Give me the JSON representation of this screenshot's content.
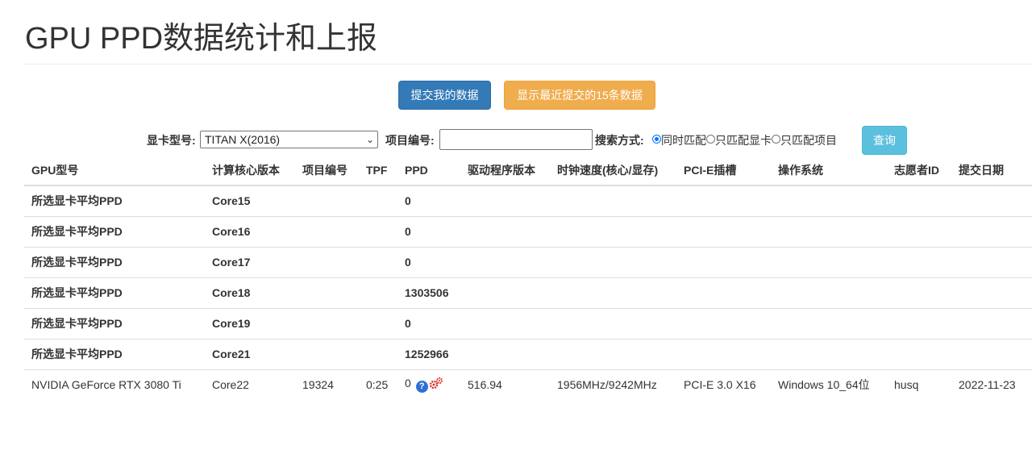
{
  "header": {
    "title": "GPU PPD数据统计和上报"
  },
  "actions": {
    "submit_label": "提交我的数据",
    "recent_label": "显示最近提交的15条数据"
  },
  "search": {
    "gpu_label": "显卡型号:",
    "gpu_selected": "TITAN X(2016)",
    "project_label": "项目编号:",
    "project_value": "",
    "mode_label": "搜索方式:",
    "modes": [
      "同时匹配",
      "只匹配显卡",
      "只匹配项目"
    ],
    "selected_mode": "同时匹配",
    "query_label": "查询"
  },
  "table": {
    "headers": [
      "GPU型号",
      "计算核心版本",
      "项目编号",
      "TPF",
      "PPD",
      "驱动程序版本",
      "时钟速度(核心/显存)",
      "PCI-E插槽",
      "操作系统",
      "志愿者ID",
      "提交日期"
    ],
    "average_rows": [
      {
        "label": "所选显卡平均PPD",
        "core": "Core15",
        "ppd": "0"
      },
      {
        "label": "所选显卡平均PPD",
        "core": "Core16",
        "ppd": "0"
      },
      {
        "label": "所选显卡平均PPD",
        "core": "Core17",
        "ppd": "0"
      },
      {
        "label": "所选显卡平均PPD",
        "core": "Core18",
        "ppd": "1303506"
      },
      {
        "label": "所选显卡平均PPD",
        "core": "Core19",
        "ppd": "0"
      },
      {
        "label": "所选显卡平均PPD",
        "core": "Core21",
        "ppd": "1252966"
      }
    ],
    "detail_rows": [
      {
        "gpu": "NVIDIA GeForce RTX 3080 Ti",
        "core": "Core22",
        "project": "19324",
        "tpf": "0:25",
        "ppd": "0",
        "ppd_icons": [
          "question-icon",
          "gear-link-icon"
        ],
        "driver": "516.94",
        "clock": "1956MHz/9242MHz",
        "pcie": "PCI-E 3.0 X16",
        "os": "Windows 10_64位",
        "volunteer": "husq",
        "date": "2022-11-23"
      }
    ]
  },
  "colors": {
    "primary": "#337ab7",
    "warning": "#f0ad4e",
    "info": "#5bc0de",
    "question_icon": "#2f6fd6",
    "gear_icon": "#d9302c"
  }
}
